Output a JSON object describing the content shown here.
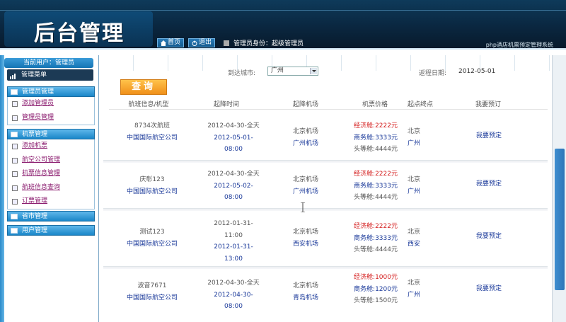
{
  "header": {
    "logo": "后台管理",
    "nav_home": "首页",
    "nav_logout": "退出",
    "role_label": "管理员身份：超级管理员",
    "system_title": "php酒店机票预定管理系统"
  },
  "sidebar": {
    "current_user": "当前用户：管理员",
    "menu_title": "管理菜单",
    "groups": [
      {
        "title": "管理员管理",
        "items": [
          "添加管理员",
          "管理员管理"
        ]
      },
      {
        "title": "机票管理",
        "items": [
          "添加机票",
          "航空公司管理",
          "机票信息管理",
          "航班信息查询",
          "订票管理"
        ]
      },
      {
        "title": "省市管理",
        "items": []
      },
      {
        "title": "用户管理",
        "items": []
      }
    ]
  },
  "search": {
    "to_city_label": "到达城市:",
    "to_city_value": "广州",
    "date_label": "返程日期:",
    "date_value": "2012-05-01",
    "query_button": "查询"
  },
  "table": {
    "headers": [
      "航班信息/机型",
      "起降时间",
      "起降机场",
      "机票价格",
      "起点终点",
      "我要预订"
    ],
    "rows": [
      {
        "flight_no": "8734次航班",
        "airline": "中国国际航空公司",
        "time1": "2012-04-30-全天",
        "time2": "2012-05-01-",
        "time3": "08:00",
        "ap_dep": "北京机场",
        "ap_arr": "广州机场",
        "economy": "经济舱:2222元",
        "business": "商务舱:3333元",
        "first": "头等舱:4444元",
        "city_from": "北京",
        "city_to": "广州",
        "book": "我要预定"
      },
      {
        "flight_no": "庆彰123",
        "airline": "中国国际航空公司",
        "time1": "2012-04-30-全天",
        "time2": "2012-05-02-",
        "time3": "08:00",
        "ap_dep": "北京机场",
        "ap_arr": "广州机场",
        "economy": "经济舱:2222元",
        "business": "商务舱:3333元",
        "first": "头等舱:4444元",
        "city_from": "北京",
        "city_to": "广州",
        "book": "我要预定"
      },
      {
        "flight_no": "测试123",
        "airline": "中国国际航空公司",
        "time1": "2012-01-31-",
        "time2": "11:00",
        "time3": "2012-01-31-",
        "time4": "13:00",
        "ap_dep": "北京机场",
        "ap_arr": "西安机场",
        "economy": "经济舱:2222元",
        "business": "商务舱:3333元",
        "first": "头等舱:4444元",
        "city_from": "北京",
        "city_to": "西安",
        "book": "我要预定"
      },
      {
        "flight_no": "波音7671",
        "airline": "中国国际航空公司",
        "time1": "2012-04-30-全天",
        "time2": "2012-04-30-",
        "time3": "08:00",
        "ap_dep": "北京机场",
        "ap_arr": "青岛机场",
        "economy": "经济舱:1000元",
        "business": "商务舱:1200元",
        "first": "头等舱:1500元",
        "city_from": "北京",
        "city_to": "广州",
        "book": "我要预定"
      }
    ]
  },
  "colors": {
    "header_dark": "#0a2740",
    "sidebar_blue": "#1a86c8",
    "query_orange": "#f0901a",
    "price_red": "#d41c1c",
    "link_blue": "#1b3a9a",
    "link_purple": "#8b1c6f"
  }
}
